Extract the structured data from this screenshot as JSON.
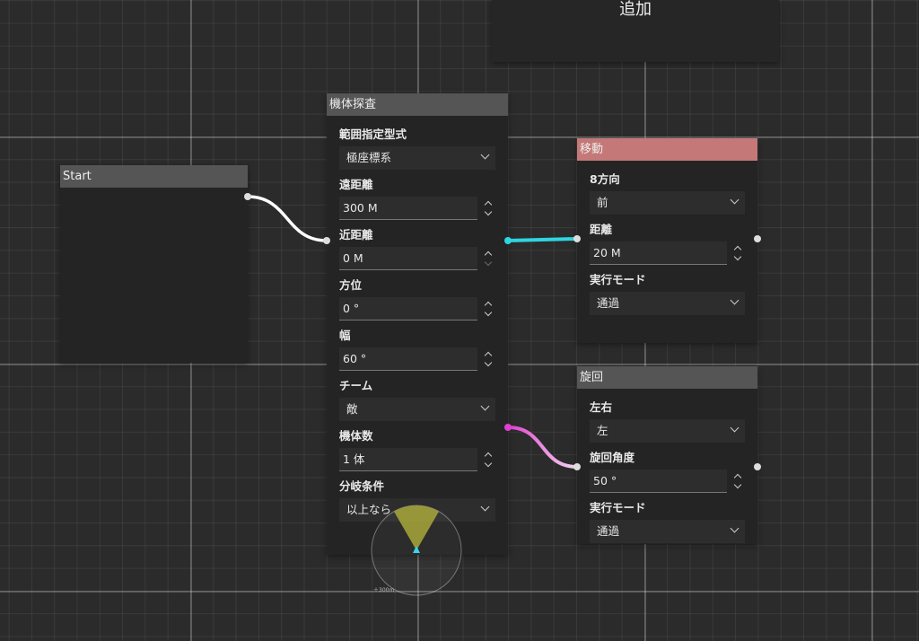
{
  "add_panel": {
    "label": "追加"
  },
  "start_node": {
    "title": "Start"
  },
  "scan_node": {
    "title": "機体探査",
    "range_type": {
      "label": "範囲指定型式",
      "value": "極座標系"
    },
    "far_distance": {
      "label": "遠距離",
      "value": "300 M"
    },
    "near_distance": {
      "label": "近距離",
      "value": "0 M"
    },
    "azimuth": {
      "label": "方位",
      "value": "0 °"
    },
    "width": {
      "label": "幅",
      "value": "60 °"
    },
    "team": {
      "label": "チーム",
      "value": "敵"
    },
    "unit_count": {
      "label": "機体数",
      "value": "1 体"
    },
    "branch_condition": {
      "label": "分岐条件",
      "value": "以上なら"
    },
    "radar": {
      "range_label": "＋300m",
      "sector_color": "#a8a83a",
      "marker_color": "#3bd3ea"
    }
  },
  "move_node": {
    "title": "移動",
    "direction": {
      "label": "8方向",
      "value": "前"
    },
    "distance": {
      "label": "距離",
      "value": "20 M"
    },
    "mode": {
      "label": "実行モード",
      "value": "通過"
    }
  },
  "turn_node": {
    "title": "旋回",
    "side": {
      "label": "左右",
      "value": "左"
    },
    "angle": {
      "label": "旋回角度",
      "value": "50 °"
    },
    "mode": {
      "label": "実行モード",
      "value": "通過"
    }
  },
  "colors": {
    "move_header": "#c47878",
    "link_cyan": "#2fd5e0",
    "link_magenta": "#e040d0",
    "link_white": "#ffffff"
  }
}
